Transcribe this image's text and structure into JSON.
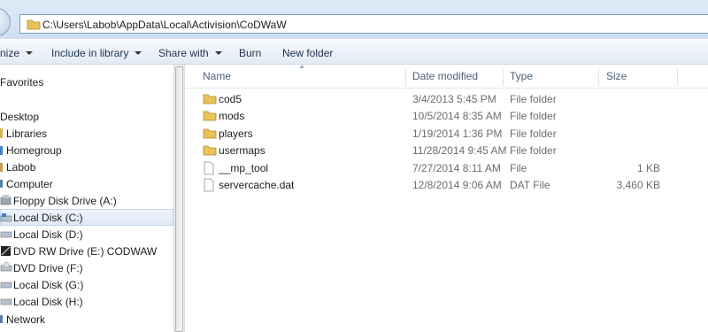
{
  "address": {
    "path": "C:\\Users\\Labob\\AppData\\Local\\Activision\\CoDWaW"
  },
  "toolbar": {
    "organize": "nize",
    "include": "Include in library",
    "share": "Share with",
    "burn": "Burn",
    "new_folder": "New folder"
  },
  "nav": {
    "favorites": "Favorites",
    "desktop": "Desktop",
    "libraries": "Libraries",
    "homegroup": "Homegroup",
    "labob": "Labob",
    "computer": "Computer",
    "floppy": "Floppy Disk Drive (A:)",
    "c": "Local Disk (C:)",
    "d": "Local Disk (D:)",
    "e": "DVD RW Drive (E:) CODWAW",
    "f": "DVD Drive (F:)",
    "g": "Local Disk (G:)",
    "h": "Local Disk (H:)",
    "network": "Network"
  },
  "columns": {
    "name": "Name",
    "date": "Date modified",
    "type": "Type",
    "size": "Size"
  },
  "files": [
    {
      "name": "cod5",
      "date": "3/4/2013 5:45 PM",
      "type": "File folder",
      "size": "",
      "icon": "folder-icon"
    },
    {
      "name": "mods",
      "date": "10/5/2014 8:35 AM",
      "type": "File folder",
      "size": "",
      "icon": "folder-icon"
    },
    {
      "name": "players",
      "date": "1/19/2014 1:36 PM",
      "type": "File folder",
      "size": "",
      "icon": "folder-icon"
    },
    {
      "name": "usermaps",
      "date": "11/28/2014 9:45 AM",
      "type": "File folder",
      "size": "",
      "icon": "folder-icon"
    },
    {
      "name": "__mp_tool",
      "date": "7/27/2014 8:11 AM",
      "type": "File",
      "size": "1 KB",
      "icon": "file-icon"
    },
    {
      "name": "servercache.dat",
      "date": "12/8/2014 9:06 AM",
      "type": "DAT File",
      "size": "3,460 KB",
      "icon": "file-icon"
    }
  ],
  "colors": {
    "folder": "#e9c25a",
    "selection": "#dfe8f5",
    "addressbar": "#dfeaf7"
  }
}
